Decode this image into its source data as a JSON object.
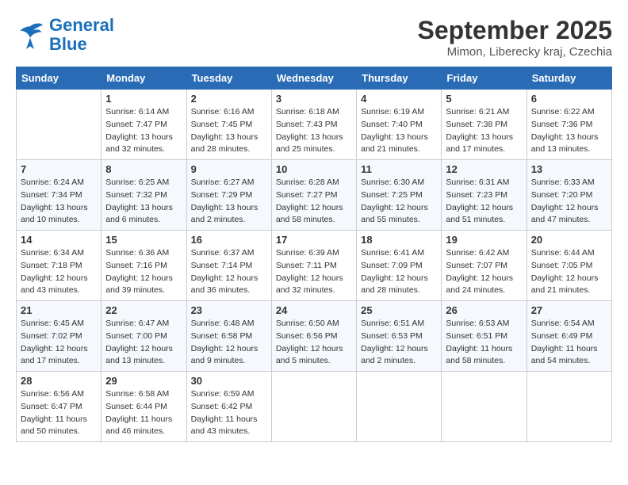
{
  "logo": {
    "general": "General",
    "blue": "Blue"
  },
  "title": "September 2025",
  "subtitle": "Mimon, Liberecky kraj, Czechia",
  "days_of_week": [
    "Sunday",
    "Monday",
    "Tuesday",
    "Wednesday",
    "Thursday",
    "Friday",
    "Saturday"
  ],
  "weeks": [
    [
      {
        "day": "",
        "info": ""
      },
      {
        "day": "1",
        "info": "Sunrise: 6:14 AM\nSunset: 7:47 PM\nDaylight: 13 hours\nand 32 minutes."
      },
      {
        "day": "2",
        "info": "Sunrise: 6:16 AM\nSunset: 7:45 PM\nDaylight: 13 hours\nand 28 minutes."
      },
      {
        "day": "3",
        "info": "Sunrise: 6:18 AM\nSunset: 7:43 PM\nDaylight: 13 hours\nand 25 minutes."
      },
      {
        "day": "4",
        "info": "Sunrise: 6:19 AM\nSunset: 7:40 PM\nDaylight: 13 hours\nand 21 minutes."
      },
      {
        "day": "5",
        "info": "Sunrise: 6:21 AM\nSunset: 7:38 PM\nDaylight: 13 hours\nand 17 minutes."
      },
      {
        "day": "6",
        "info": "Sunrise: 6:22 AM\nSunset: 7:36 PM\nDaylight: 13 hours\nand 13 minutes."
      }
    ],
    [
      {
        "day": "7",
        "info": "Sunrise: 6:24 AM\nSunset: 7:34 PM\nDaylight: 13 hours\nand 10 minutes."
      },
      {
        "day": "8",
        "info": "Sunrise: 6:25 AM\nSunset: 7:32 PM\nDaylight: 13 hours\nand 6 minutes."
      },
      {
        "day": "9",
        "info": "Sunrise: 6:27 AM\nSunset: 7:29 PM\nDaylight: 13 hours\nand 2 minutes."
      },
      {
        "day": "10",
        "info": "Sunrise: 6:28 AM\nSunset: 7:27 PM\nDaylight: 12 hours\nand 58 minutes."
      },
      {
        "day": "11",
        "info": "Sunrise: 6:30 AM\nSunset: 7:25 PM\nDaylight: 12 hours\nand 55 minutes."
      },
      {
        "day": "12",
        "info": "Sunrise: 6:31 AM\nSunset: 7:23 PM\nDaylight: 12 hours\nand 51 minutes."
      },
      {
        "day": "13",
        "info": "Sunrise: 6:33 AM\nSunset: 7:20 PM\nDaylight: 12 hours\nand 47 minutes."
      }
    ],
    [
      {
        "day": "14",
        "info": "Sunrise: 6:34 AM\nSunset: 7:18 PM\nDaylight: 12 hours\nand 43 minutes."
      },
      {
        "day": "15",
        "info": "Sunrise: 6:36 AM\nSunset: 7:16 PM\nDaylight: 12 hours\nand 39 minutes."
      },
      {
        "day": "16",
        "info": "Sunrise: 6:37 AM\nSunset: 7:14 PM\nDaylight: 12 hours\nand 36 minutes."
      },
      {
        "day": "17",
        "info": "Sunrise: 6:39 AM\nSunset: 7:11 PM\nDaylight: 12 hours\nand 32 minutes."
      },
      {
        "day": "18",
        "info": "Sunrise: 6:41 AM\nSunset: 7:09 PM\nDaylight: 12 hours\nand 28 minutes."
      },
      {
        "day": "19",
        "info": "Sunrise: 6:42 AM\nSunset: 7:07 PM\nDaylight: 12 hours\nand 24 minutes."
      },
      {
        "day": "20",
        "info": "Sunrise: 6:44 AM\nSunset: 7:05 PM\nDaylight: 12 hours\nand 21 minutes."
      }
    ],
    [
      {
        "day": "21",
        "info": "Sunrise: 6:45 AM\nSunset: 7:02 PM\nDaylight: 12 hours\nand 17 minutes."
      },
      {
        "day": "22",
        "info": "Sunrise: 6:47 AM\nSunset: 7:00 PM\nDaylight: 12 hours\nand 13 minutes."
      },
      {
        "day": "23",
        "info": "Sunrise: 6:48 AM\nSunset: 6:58 PM\nDaylight: 12 hours\nand 9 minutes."
      },
      {
        "day": "24",
        "info": "Sunrise: 6:50 AM\nSunset: 6:56 PM\nDaylight: 12 hours\nand 5 minutes."
      },
      {
        "day": "25",
        "info": "Sunrise: 6:51 AM\nSunset: 6:53 PM\nDaylight: 12 hours\nand 2 minutes."
      },
      {
        "day": "26",
        "info": "Sunrise: 6:53 AM\nSunset: 6:51 PM\nDaylight: 11 hours\nand 58 minutes."
      },
      {
        "day": "27",
        "info": "Sunrise: 6:54 AM\nSunset: 6:49 PM\nDaylight: 11 hours\nand 54 minutes."
      }
    ],
    [
      {
        "day": "28",
        "info": "Sunrise: 6:56 AM\nSunset: 6:47 PM\nDaylight: 11 hours\nand 50 minutes."
      },
      {
        "day": "29",
        "info": "Sunrise: 6:58 AM\nSunset: 6:44 PM\nDaylight: 11 hours\nand 46 minutes."
      },
      {
        "day": "30",
        "info": "Sunrise: 6:59 AM\nSunset: 6:42 PM\nDaylight: 11 hours\nand 43 minutes."
      },
      {
        "day": "",
        "info": ""
      },
      {
        "day": "",
        "info": ""
      },
      {
        "day": "",
        "info": ""
      },
      {
        "day": "",
        "info": ""
      }
    ]
  ]
}
